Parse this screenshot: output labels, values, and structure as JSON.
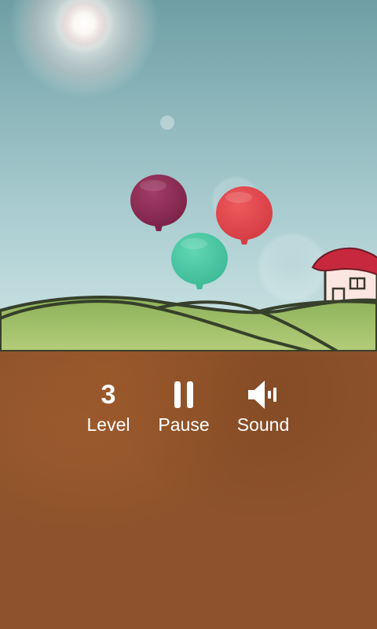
{
  "hud": {
    "level_value": "3",
    "level_label": "Level",
    "pause_label": "Pause",
    "sound_label": "Sound"
  },
  "icons": {
    "pause": "pause-icon",
    "sound": "speaker-icon"
  },
  "colors": {
    "sky_top": "#6f9ea3",
    "sky_bottom": "#c2dee0",
    "ground": "#8e532c",
    "hill": "#9fbf59",
    "balloon_purple": "#8e2d55",
    "balloon_red": "#e04a4f",
    "balloon_green": "#4ec9a4",
    "roof": "#c8283e"
  }
}
